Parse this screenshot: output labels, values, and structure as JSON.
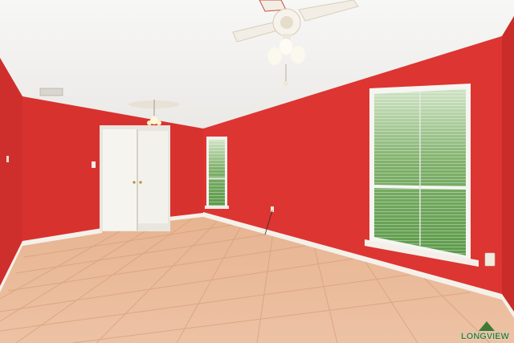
{
  "scene": {
    "description_free": true,
    "colors": {
      "ceiling": "#f3f2f0",
      "wall_left": "#d3302d",
      "wall_back": "#d8322e",
      "wall_right": "#dc3431",
      "floor": "#e8b592",
      "floor_grout": "#d79e7a",
      "baseboard": "#f4f1ea",
      "door": "#f5f3ee",
      "window_glass_green": "#5e9a4e",
      "window_frame": "#f5f5f2",
      "fan_body": "#f5f0e8",
      "fan_accent": "#c9503e"
    }
  },
  "watermark": {
    "logo_text": "LONGVIEW",
    "brand_color": "#3d7a3a"
  }
}
